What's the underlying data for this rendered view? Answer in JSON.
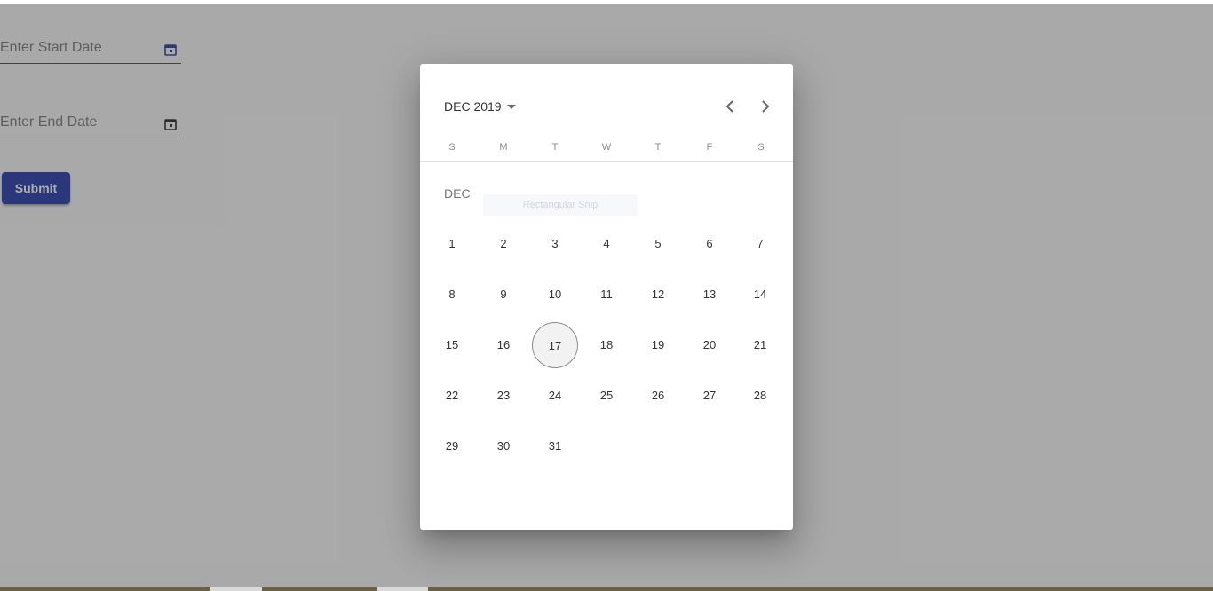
{
  "form": {
    "start_placeholder": "Enter Start Date",
    "end_placeholder": "Enter End Date",
    "submit_label": "Submit"
  },
  "datepicker": {
    "period_label": "DEC 2019",
    "weekdays": [
      "S",
      "M",
      "T",
      "W",
      "T",
      "F",
      "S"
    ],
    "month_label": "DEC",
    "ghost_tooltip": "Rectangular Snip",
    "first_weekday_index": 0,
    "days": [
      "1",
      "2",
      "3",
      "4",
      "5",
      "6",
      "7",
      "8",
      "9",
      "10",
      "11",
      "12",
      "13",
      "14",
      "15",
      "16",
      "17",
      "18",
      "19",
      "20",
      "21",
      "22",
      "23",
      "24",
      "25",
      "26",
      "27",
      "28",
      "29",
      "30",
      "31"
    ],
    "today": "17"
  },
  "colors": {
    "primary": "#3f51b5",
    "overlay": "rgba(0,0,0,0.32)",
    "background": "#fafafa"
  },
  "icons": {
    "start_calendar": "calendar-icon",
    "end_calendar": "calendar-icon",
    "prev": "chevron-left-icon",
    "next": "chevron-right-icon",
    "period_caret": "caret-down-icon"
  }
}
